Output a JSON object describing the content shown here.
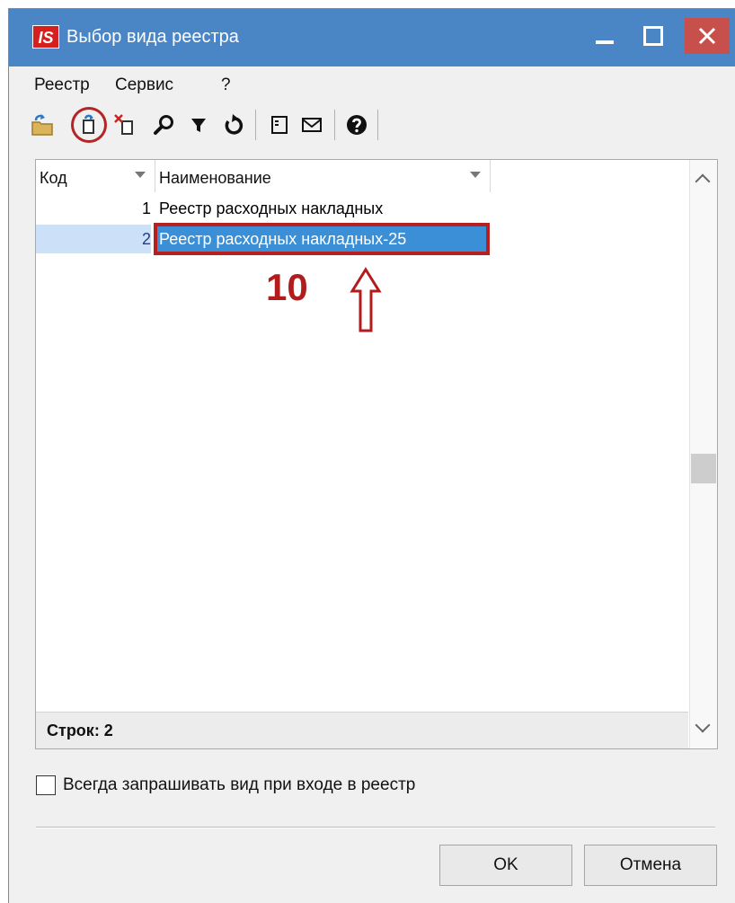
{
  "window": {
    "logo_text": "IS",
    "title": "Выбор вида реестра"
  },
  "menu": [
    "Реестр",
    "Сервис",
    "?"
  ],
  "toolbar": {
    "icons": [
      "folder-open-icon",
      "add-document-icon",
      "delete-document-icon",
      "search-icon",
      "filter-icon",
      "refresh-icon",
      "form-icon",
      "mail-icon",
      "help-icon"
    ],
    "highlighted_icon": "add-document-icon"
  },
  "grid": {
    "columns": [
      "Код",
      "Наименование"
    ],
    "rows": [
      {
        "code": "1",
        "name": "Реестр расходных накладных"
      },
      {
        "code": "2",
        "name": "Реестр расходных накладных-25"
      }
    ],
    "selected_row": 2,
    "footer": "Строк: 2"
  },
  "annotation": {
    "number": "10",
    "color": "#b21c1c"
  },
  "options": {
    "always_ask_label": "Всегда запрашивать вид при входе в реестр",
    "always_ask_checked": false
  },
  "buttons": {
    "ok": "OK",
    "cancel": "Отмена"
  },
  "colors": {
    "titlebar": "#4a86c6",
    "close_button": "#c7504d",
    "selection": "#3b8fd6",
    "highlight_border": "#b81f1f"
  }
}
